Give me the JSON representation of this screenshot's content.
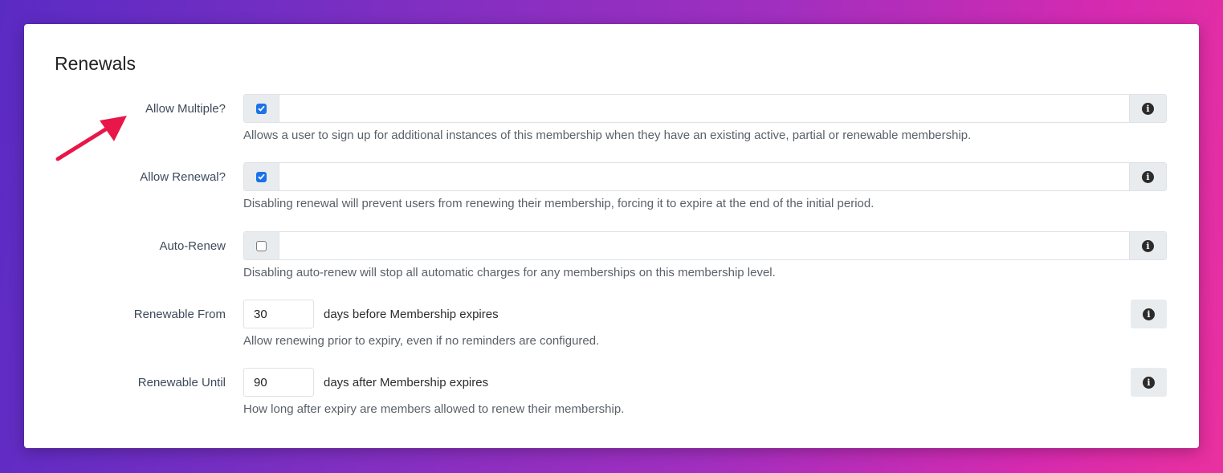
{
  "section": {
    "title": "Renewals"
  },
  "rows": [
    {
      "label": "Allow Multiple?",
      "checked": true,
      "help": "Allows a user to sign up for additional instances of this membership when they have an existing active, partial or renewable membership."
    },
    {
      "label": "Allow Renewal?",
      "checked": true,
      "help": "Disabling renewal will prevent users from renewing their membership, forcing it to expire at the end of the initial period."
    },
    {
      "label": "Auto-Renew",
      "checked": false,
      "help": "Disabling auto-renew will stop all automatic charges for any memberships on this membership level."
    }
  ],
  "renewable_from": {
    "label": "Renewable From",
    "value": "30",
    "suffix": "days before Membership expires",
    "help": "Allow renewing prior to expiry, even if no reminders are configured."
  },
  "renewable_until": {
    "label": "Renewable Until",
    "value": "90",
    "suffix": "days after Membership expires",
    "help": "How long after expiry are members allowed to renew their membership."
  },
  "icons": {
    "info": "info-circle-icon",
    "checkbox_checked": "checkbox-checked-icon",
    "checkbox_unchecked": "checkbox-unchecked-icon",
    "annotation_arrow": "red-arrow-icon"
  },
  "colors": {
    "accent": "#1a73e8",
    "arrow": "#e8174a",
    "addon_bg": "#e9ecef"
  }
}
